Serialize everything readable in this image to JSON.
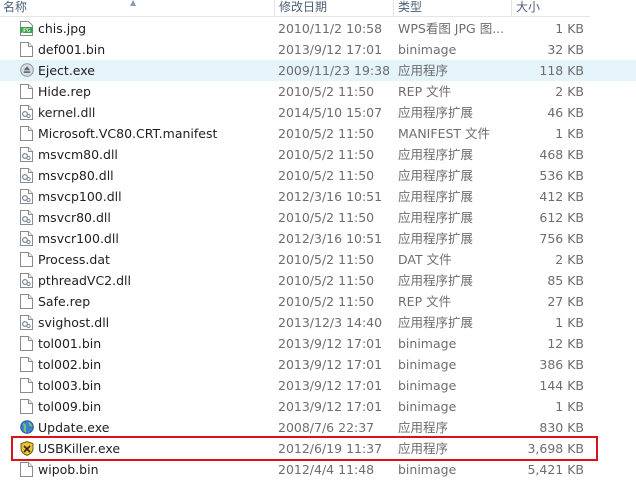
{
  "columns": {
    "name": "名称",
    "date": "修改日期",
    "type": "类型",
    "size": "大小"
  },
  "files": [
    {
      "name": "chis.jpg",
      "date": "2010/11/2 10:58",
      "type": "WPS看图 JPG 图...",
      "size": "1 KB",
      "icon": "jpg-image-icon"
    },
    {
      "name": "def001.bin",
      "date": "2013/9/12 17:01",
      "type": "binimage",
      "size": "32 KB",
      "icon": "file-icon"
    },
    {
      "name": "Eject.exe",
      "date": "2009/11/23 19:38",
      "type": "应用程序",
      "size": "118 KB",
      "icon": "eject-app-icon"
    },
    {
      "name": "Hide.rep",
      "date": "2010/5/2 11:50",
      "type": "REP 文件",
      "size": "2 KB",
      "icon": "file-icon"
    },
    {
      "name": "kernel.dll",
      "date": "2014/5/10 15:07",
      "type": "应用程序扩展",
      "size": "46 KB",
      "icon": "dll-icon"
    },
    {
      "name": "Microsoft.VC80.CRT.manifest",
      "date": "2010/5/2 11:50",
      "type": "MANIFEST 文件",
      "size": "1 KB",
      "icon": "file-icon"
    },
    {
      "name": "msvcm80.dll",
      "date": "2010/5/2 11:50",
      "type": "应用程序扩展",
      "size": "468 KB",
      "icon": "dll-icon"
    },
    {
      "name": "msvcp80.dll",
      "date": "2010/5/2 11:50",
      "type": "应用程序扩展",
      "size": "536 KB",
      "icon": "dll-icon"
    },
    {
      "name": "msvcp100.dll",
      "date": "2012/3/16 10:51",
      "type": "应用程序扩展",
      "size": "412 KB",
      "icon": "dll-icon"
    },
    {
      "name": "msvcr80.dll",
      "date": "2010/5/2 11:50",
      "type": "应用程序扩展",
      "size": "612 KB",
      "icon": "dll-icon"
    },
    {
      "name": "msvcr100.dll",
      "date": "2012/3/16 10:51",
      "type": "应用程序扩展",
      "size": "756 KB",
      "icon": "dll-icon"
    },
    {
      "name": "Process.dat",
      "date": "2010/5/2 11:50",
      "type": "DAT 文件",
      "size": "2 KB",
      "icon": "file-icon"
    },
    {
      "name": "pthreadVC2.dll",
      "date": "2010/5/2 11:50",
      "type": "应用程序扩展",
      "size": "85 KB",
      "icon": "dll-icon"
    },
    {
      "name": "Safe.rep",
      "date": "2010/5/2 11:50",
      "type": "REP 文件",
      "size": "27 KB",
      "icon": "file-icon"
    },
    {
      "name": "svighost.dll",
      "date": "2013/12/3 14:40",
      "type": "应用程序扩展",
      "size": "1 KB",
      "icon": "dll-icon"
    },
    {
      "name": "tol001.bin",
      "date": "2013/9/12 17:01",
      "type": "binimage",
      "size": "12 KB",
      "icon": "file-icon"
    },
    {
      "name": "tol002.bin",
      "date": "2013/9/12 17:01",
      "type": "binimage",
      "size": "386 KB",
      "icon": "file-icon"
    },
    {
      "name": "tol003.bin",
      "date": "2013/9/12 17:01",
      "type": "binimage",
      "size": "144 KB",
      "icon": "file-icon"
    },
    {
      "name": "tol009.bin",
      "date": "2013/9/12 17:01",
      "type": "binimage",
      "size": "1 KB",
      "icon": "file-icon"
    },
    {
      "name": "Update.exe",
      "date": "2008/7/6 22:37",
      "type": "应用程序",
      "size": "830 KB",
      "icon": "globe-app-icon"
    },
    {
      "name": "USBKiller.exe",
      "date": "2012/6/19 11:37",
      "type": "应用程序",
      "size": "3,698 KB",
      "icon": "shield-app-icon"
    },
    {
      "name": "wipob.bin",
      "date": "2012/4/4 11:48",
      "type": "binimage",
      "size": "5,421 KB",
      "icon": "file-icon"
    }
  ],
  "hover_row": "Eject.exe",
  "highlighted_row": "USBKiller.exe",
  "colors": {
    "hover_bg": "#e5f3fb",
    "highlight_border": "#d8131b",
    "header_text": "#4c607a",
    "secondary_text": "#6d6d6d"
  }
}
